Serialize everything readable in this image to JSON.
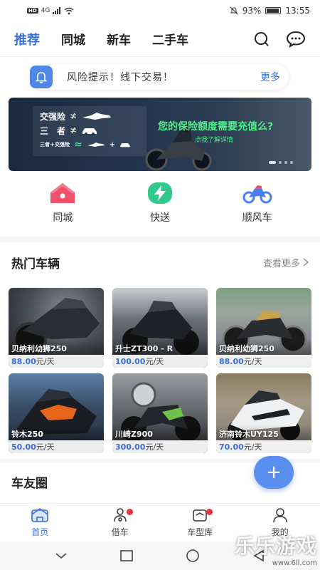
{
  "status_bar": {
    "signal_text": "4G",
    "battery": "93%",
    "time": "13:55"
  },
  "header": {
    "tabs": [
      {
        "label": "推荐",
        "active": true
      },
      {
        "label": "同城",
        "active": false
      },
      {
        "label": "新车",
        "active": false
      },
      {
        "label": "二手车",
        "active": false
      }
    ],
    "icons": [
      "search-icon",
      "message-icon"
    ]
  },
  "notice": {
    "text": "风险提示！线下交易！",
    "more": "更多",
    "icon": "bell-icon"
  },
  "banner": {
    "row1_label": "交强险",
    "row2_label": "三　者",
    "row3_label": "三者＋交强险",
    "title": "您的保险额度需要充值么?",
    "subtitle": "点我了解详情",
    "dots": 4
  },
  "quick_entries": [
    {
      "label": "同城",
      "icon": "home-icon",
      "color": "#f0506a"
    },
    {
      "label": "快送",
      "icon": "lightning-icon",
      "color": "#2fc98a"
    },
    {
      "label": "顺风车",
      "icon": "motorcycle-icon",
      "color": "#4a7ff0"
    }
  ],
  "hot_section": {
    "title": "热门车辆",
    "more": "查看更多"
  },
  "vehicles": [
    {
      "name": "贝纳利幼狮250",
      "price": "88.00",
      "unit": "元/天"
    },
    {
      "name": "升士ZT300 - R",
      "price": "100.00",
      "unit": "元/天"
    },
    {
      "name": "贝纳利幼狮250",
      "price": "88.00",
      "unit": "元/天"
    },
    {
      "name": "铃木250",
      "price": "50.00",
      "unit": "元/天"
    },
    {
      "name": "川崎Z900",
      "price": "300.00",
      "unit": "元/天"
    },
    {
      "name": "济南铃木UY125",
      "price": "70.00",
      "unit": "元/天"
    }
  ],
  "circle_section": {
    "title": "车友圈"
  },
  "fab": {
    "label": "+"
  },
  "bottom_nav": [
    {
      "label": "首页",
      "icon": "home-nav-icon",
      "active": true,
      "dot": false
    },
    {
      "label": "借车",
      "icon": "scooter-icon",
      "active": false,
      "dot": true
    },
    {
      "label": "车型库",
      "icon": "box-icon",
      "active": false,
      "dot": true
    },
    {
      "label": "我的",
      "icon": "user-icon",
      "active": false,
      "dot": false
    }
  ],
  "watermark": {
    "main": "乐乐游戏",
    "sub": "www.6ll.com"
  },
  "colors": {
    "accent": "#3a6fd8",
    "fab": "#5a8ff0",
    "badge": "#e8323c"
  }
}
